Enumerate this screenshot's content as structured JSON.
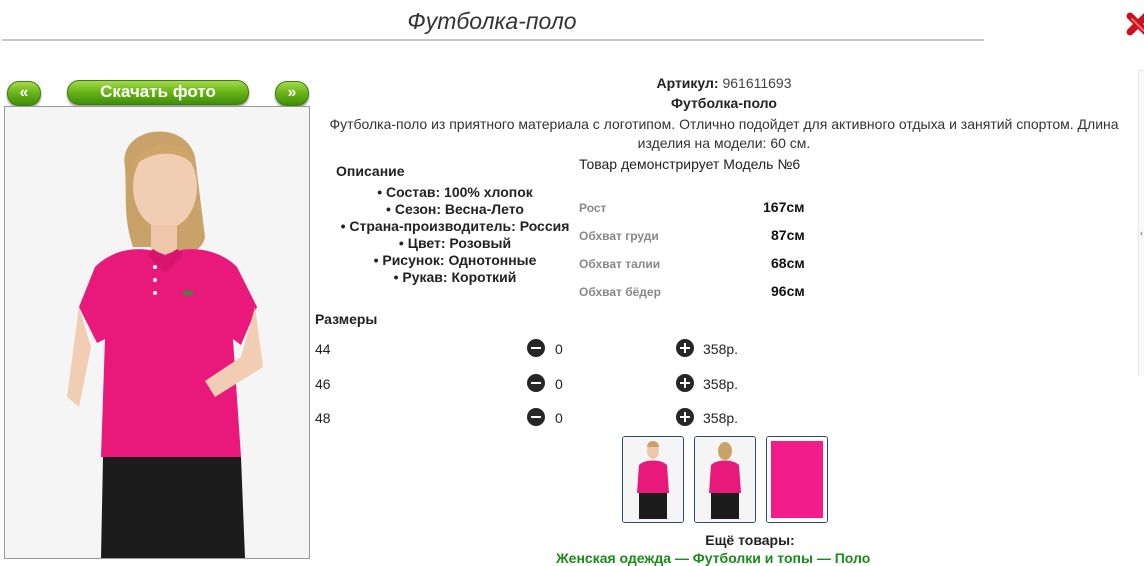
{
  "header": {
    "title": "Футболка-поло"
  },
  "gallery": {
    "prev_label": "«",
    "download_label": "Скачать фото",
    "next_label": "»"
  },
  "product": {
    "article_label": "Артикул:",
    "article_value": "961611693",
    "name": "Футболка-поло",
    "description": "Футболка-поло из приятного материала с логотипом. Отлично подойдет для активного отдыха и занятий спортом. Длина изделия на модели: 60 см.",
    "model_note": "Товар демонстрирует Модель №6"
  },
  "details": {
    "title": "Описание",
    "attributes": [
      "Состав: 100% хлопок",
      "Сезон: Весна-Лето",
      "Страна-производитель: Россия",
      "Цвет: Розовый",
      "Рисунок: Однотонные",
      "Рукав: Короткий"
    ]
  },
  "measurements": [
    {
      "label": "Рост",
      "value": "167см"
    },
    {
      "label": "Обхват груди",
      "value": "87см"
    },
    {
      "label": "Обхват талии",
      "value": "68см"
    },
    {
      "label": "Обхват бёдер",
      "value": "96см"
    }
  ],
  "sizes": {
    "title": "Размеры",
    "rows": [
      {
        "size": "44",
        "qty": "0",
        "price": "358р."
      },
      {
        "size": "46",
        "qty": "0",
        "price": "358р."
      },
      {
        "size": "48",
        "qty": "0",
        "price": "358р."
      }
    ]
  },
  "more": {
    "title": "Ещё товары:",
    "links": [
      "Женская одежда",
      "Футболки и топы",
      "Поло"
    ]
  },
  "icons": {
    "close": "close-x-icon",
    "minus": "minus-circle-icon",
    "plus": "plus-circle-icon"
  },
  "colors": {
    "accent_green": "#6cb619",
    "product_pink": "#e8197a",
    "close_red": "#c8121e",
    "link_green": "#1a8a1a"
  }
}
